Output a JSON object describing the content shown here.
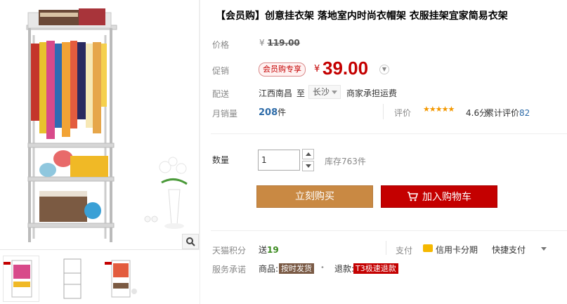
{
  "product": {
    "title": "【会员购】创意挂衣架 落地室内时尚衣帽架 衣服挂架宜家简易衣架"
  },
  "labels": {
    "price": "价格",
    "promo": "促销",
    "delivery": "配送",
    "monthly_sales": "月销量",
    "reviews": "评价",
    "quantity": "数量",
    "tmall_points": "天猫积分",
    "payment": "支付",
    "service": "服务承诺"
  },
  "price": {
    "original_symbol": "¥",
    "original": "119.00",
    "promo_badge": "会员购专享",
    "current_symbol": "¥",
    "current": "39.00"
  },
  "shipping": {
    "from": "江西南昌",
    "to_word": "至",
    "city": "长沙",
    "fee": "商家承担运费"
  },
  "sales": {
    "count": "208",
    "unit": "件"
  },
  "reviews": {
    "stars": 4.6,
    "stars_glyphs": "★★★★★",
    "score": "4.6分",
    "total_label": "累计评价",
    "total": "82"
  },
  "purchase": {
    "quantity": "1",
    "stock": "库存763件",
    "buy_now": "立刻购买",
    "add_to_cart": "加入购物车"
  },
  "extras": {
    "points_prefix": "送",
    "points": "19",
    "card_installment": "信用卡分期",
    "quick_pay": "快捷支付",
    "service_goods": "商品:",
    "service_goods_tag": "按时发货",
    "service_refund": "退款:",
    "service_refund_tag": "T3极速退款"
  },
  "colors": {
    "price_red": "#c40000",
    "buy_brown": "#c98943",
    "cart_red": "#c40000",
    "link_blue": "#2d6ba8",
    "star_orange": "#f39800"
  },
  "icons": {
    "zoom": "magnifier-icon",
    "cart": "cart-icon",
    "card": "credit-card-icon"
  }
}
